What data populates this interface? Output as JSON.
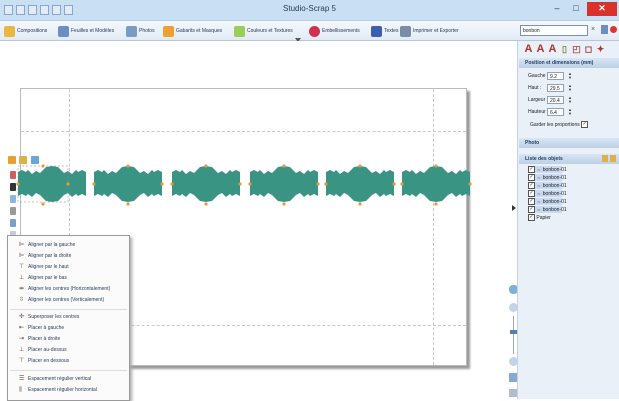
{
  "window": {
    "title": "Studio-Scrap 5"
  },
  "toolbar": {
    "items": [
      {
        "label": "Compositions",
        "icon": "compositions-icon",
        "color": "#e8b842"
      },
      {
        "label": "Feuilles et Modèles",
        "icon": "sheets-icon",
        "color": "#6b8fc4"
      },
      {
        "label": "Photos",
        "icon": "photos-icon",
        "color": "#7b9bc0"
      },
      {
        "label": "Gabarits et Masques",
        "icon": "masks-icon",
        "color": "#f0a030"
      },
      {
        "label": "Couleurs et Textures",
        "icon": "colors-icon",
        "color": "#9ccd5a"
      },
      {
        "label": "Embellissements",
        "icon": "embellish-icon",
        "color": "#d0304a"
      },
      {
        "label": "Textes",
        "icon": "text-icon",
        "color": "#3a5fb0"
      },
      {
        "label": "Imprimer et Exporter",
        "icon": "print-icon",
        "color": "#7a8ca8"
      }
    ],
    "search_value": "bonbon"
  },
  "window_buttons": {
    "minimize": "–",
    "maximize": "□",
    "close": "✕"
  },
  "panel": {
    "position_title": "Position et dimensions (mm)",
    "fields": [
      {
        "label": "Gauche :",
        "value": "9.2"
      },
      {
        "label": "Haut :",
        "value": "29.5"
      },
      {
        "label": "Largeur :",
        "value": "20.4"
      },
      {
        "label": "Hauteur :",
        "value": "6.4"
      }
    ],
    "keep_proportions": "Garder les proportions",
    "photo_title": "Photo",
    "objects_title": "Liste des objets",
    "objects": [
      {
        "label": "bonbon-01",
        "selected": true
      },
      {
        "label": "bonbon-01",
        "selected": true
      },
      {
        "label": "bonbon-01",
        "selected": true
      },
      {
        "label": "bonbon-01",
        "selected": true
      },
      {
        "label": "bonbon-01",
        "selected": true
      },
      {
        "label": "bonbon-01",
        "selected": true
      },
      {
        "label": "Papier",
        "selected": false
      }
    ]
  },
  "menu": {
    "items": [
      {
        "label": "Aligner par la gauche",
        "icon": "align-left-icon",
        "glyph": "⊫"
      },
      {
        "label": "Aligner par la droite",
        "icon": "align-right-icon",
        "glyph": "⊫"
      },
      {
        "label": "Aligner par le haut",
        "icon": "align-top-icon",
        "glyph": "⊤"
      },
      {
        "label": "Aligner par le bas",
        "icon": "align-bottom-icon",
        "glyph": "⊥"
      },
      {
        "label": "Aligner les centres (Horizontalement)",
        "icon": "align-center-h-icon",
        "glyph": "⇹"
      },
      {
        "label": "Aligner les centres (Verticalement)",
        "icon": "align-center-v-icon",
        "glyph": "⇳"
      },
      {
        "label": "Superposer les centres",
        "icon": "overlay-centers-icon",
        "glyph": "✣"
      },
      {
        "label": "Placer à gauche",
        "icon": "place-left-icon",
        "glyph": "⇤"
      },
      {
        "label": "Placer à droite",
        "icon": "place-right-icon",
        "glyph": "⇥"
      },
      {
        "label": "Placer au-dessus",
        "icon": "place-above-icon",
        "glyph": "⊥"
      },
      {
        "label": "Placer en dessous",
        "icon": "place-below-icon",
        "glyph": "⊤"
      },
      {
        "label": "Espacement régulier vertical",
        "icon": "spacing-vertical-icon",
        "glyph": "☰"
      },
      {
        "label": "Espacement régulier horizontal",
        "icon": "spacing-horizontal-icon",
        "glyph": "⫼"
      }
    ]
  },
  "colors": {
    "candy": "#3a9484",
    "accent": "#c9dff3"
  }
}
